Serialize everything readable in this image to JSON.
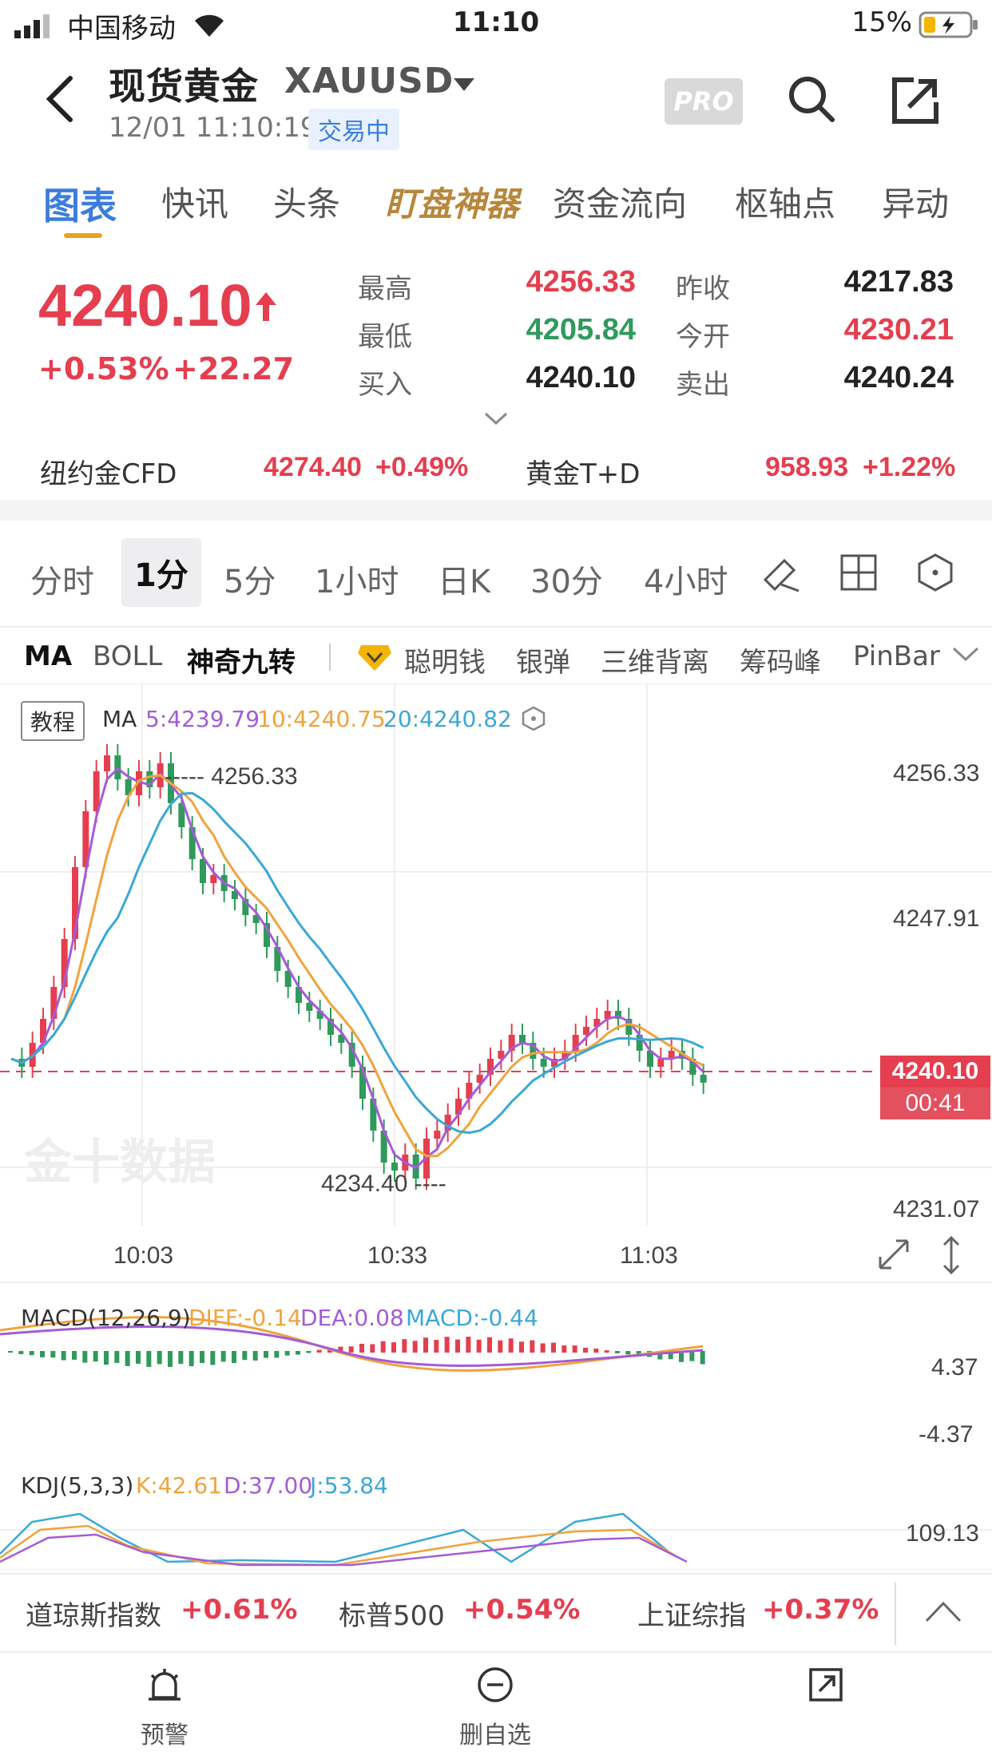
{
  "status_bar": {
    "carrier": "中国移动",
    "time": "11:10",
    "battery": "15%"
  },
  "header": {
    "title": "现货黄金",
    "symbol": "XAUUSD",
    "timestamp": "12/01 11:10:19",
    "status_badge": "交易中",
    "pro_label": "PRO"
  },
  "tabs": [
    "图表",
    "快讯",
    "头条",
    "盯盘神器",
    "资金流向",
    "枢轴点",
    "异动"
  ],
  "quote": {
    "price": "4240.10",
    "change_pct": "+0.53%",
    "change": "+22.27",
    "high_label": "最高",
    "high": "4256.33",
    "low_label": "最低",
    "low": "4205.84",
    "bid_label": "买入",
    "bid": "4240.10",
    "prev_close_label": "昨收",
    "prev_close": "4217.83",
    "open_label": "今开",
    "open": "4230.21",
    "ask_label": "卖出",
    "ask": "4240.24"
  },
  "related": [
    {
      "name": "纽约金CFD",
      "price": "4274.40",
      "change": "+0.49%"
    },
    {
      "name": "黄金T+D",
      "price": "958.93",
      "change": "+1.22%"
    }
  ],
  "periods": [
    "分时",
    "1分",
    "5分",
    "1小时",
    "日K",
    "30分",
    "4小时"
  ],
  "active_period": "1分",
  "indicators": [
    "MA",
    "BOLL",
    "神奇九转",
    "聪明钱",
    "银弹",
    "三维背离",
    "筹码峰",
    "PinBar"
  ],
  "chart_panel": {
    "tutorial_label": "教程",
    "ma_label": "MA",
    "ma5": "5:4239.79",
    "ma10": "10:4240.75",
    "ma20": "20:4240.82",
    "high_marker": "----- 4256.33",
    "low_marker": "4234.40 ----",
    "y_ticks": [
      "4256.33",
      "4247.91",
      "4231.07"
    ],
    "x_ticks": [
      "10:03",
      "10:33",
      "11:03"
    ],
    "current_price": "4240.10",
    "countdown": "00:41",
    "watermark": "金十数据",
    "macd": {
      "label": "MACD(12,26,9)",
      "diff": "DIFF:-0.14",
      "dea": "DEA:0.08",
      "macd": "MACD:-0.44",
      "top": "4.37",
      "bottom": "-4.37"
    },
    "kdj": {
      "label": "KDJ(5,3,3)",
      "k": "K:42.61",
      "d": "D:37.00",
      "j": "J:53.84",
      "top": "109.13"
    },
    "colors": {
      "up": "#e53e4f",
      "down": "#2f9a5b",
      "ma5": "#a55bd6",
      "ma10": "#f0a33c",
      "ma20": "#3aa8d8"
    }
  },
  "ticker": [
    {
      "name": "道琼斯指数",
      "change": "+0.61%"
    },
    {
      "name": "标普500",
      "change": "+0.54%"
    },
    {
      "name": "上证综指",
      "change": "+0.37%"
    }
  ],
  "tab_bar": [
    {
      "label": "预警",
      "icon": "alarm-icon"
    },
    {
      "label": "删自选",
      "icon": "minus-circle-icon"
    },
    {
      "label": "",
      "icon": "share-icon"
    }
  ]
}
